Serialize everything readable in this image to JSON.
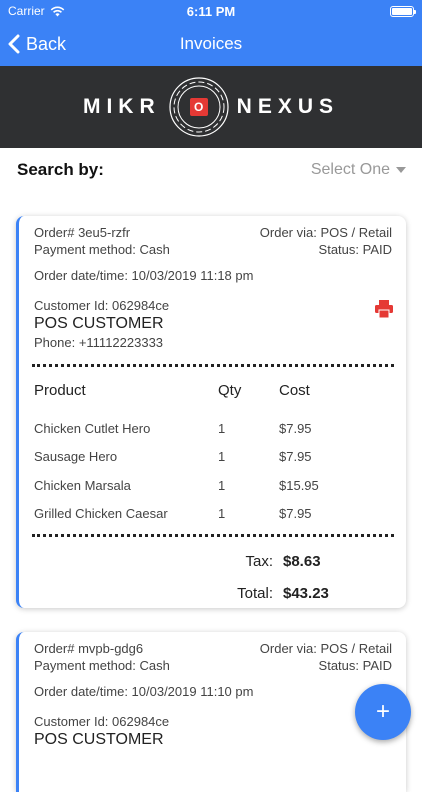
{
  "status_bar": {
    "carrier": "Carrier",
    "time": "6:11 PM"
  },
  "nav": {
    "back_label": "Back",
    "title": "Invoices"
  },
  "brand": {
    "left": "MIKR",
    "right": "NEXUS",
    "logo_letter": "O"
  },
  "search": {
    "label": "Search by:",
    "select_value": "Select One"
  },
  "orders": [
    {
      "order_no": "Order# 3eu5-rzfr",
      "order_via": "Order via: POS / Retail",
      "payment": "Payment method: Cash",
      "status": "Status: PAID",
      "datetime": "Order date/time: 10/03/2019 11:18 pm",
      "customer_id": "Customer Id: 062984ce",
      "customer_name": "POS CUSTOMER",
      "phone": "Phone: +11112223333",
      "headers": {
        "product": "Product",
        "qty": "Qty",
        "cost": "Cost"
      },
      "items": [
        {
          "product": "Chicken Cutlet Hero",
          "qty": "1",
          "cost": "$7.95"
        },
        {
          "product": "Sausage Hero",
          "qty": "1",
          "cost": "$7.95"
        },
        {
          "product": "Chicken Marsala",
          "qty": "1",
          "cost": "$15.95"
        },
        {
          "product": "Grilled Chicken Caesar",
          "qty": "1",
          "cost": "$7.95"
        }
      ],
      "tax_label": "Tax:",
      "tax_value": "$8.63",
      "total_label": "Total:",
      "total_value": "$43.23"
    },
    {
      "order_no": "Order# mvpb-gdg6",
      "order_via": "Order via: POS / Retail",
      "payment": "Payment method: Cash",
      "status": "Status: PAID",
      "datetime": "Order date/time: 10/03/2019 11:10 pm",
      "customer_id": "Customer Id: 062984ce",
      "customer_name": "POS CUSTOMER"
    }
  ],
  "fab": {
    "label": "+"
  },
  "colors": {
    "primary": "#3b82f6",
    "banner": "#2f3032",
    "print_icon": "#e53935"
  }
}
